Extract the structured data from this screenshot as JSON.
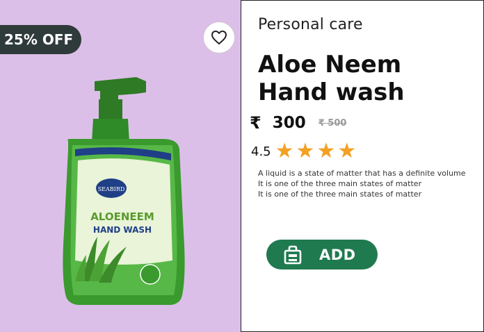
{
  "product": {
    "discount_badge": "25% OFF",
    "category": "Personal care",
    "title_line1": "Aloe Neem",
    "title_line2": "Hand wash",
    "currency_symbol": "₹",
    "price": "300",
    "old_price": "₹ 500",
    "rating": "4.5",
    "stars_filled": 4,
    "description": [
      "A liquid is a state of matter that has a definite volume",
      "It is one of the three main states of matter",
      "It is one of the three main states of matter"
    ],
    "add_button_label": "ADD",
    "bottle_label": {
      "brand": "SEABIRD",
      "line1": "ALOENEEM",
      "line2": "HAND WASH"
    }
  },
  "colors": {
    "media_background": "#dcbfe8",
    "badge_background": "#2f3b3a",
    "add_button": "#1f7a4f",
    "star": "#f3a023",
    "bottle_green": "#3a9a2e"
  },
  "icons": {
    "favorite": "heart-outline-icon",
    "add": "shopping-bag-icon",
    "star": "star-icon"
  }
}
